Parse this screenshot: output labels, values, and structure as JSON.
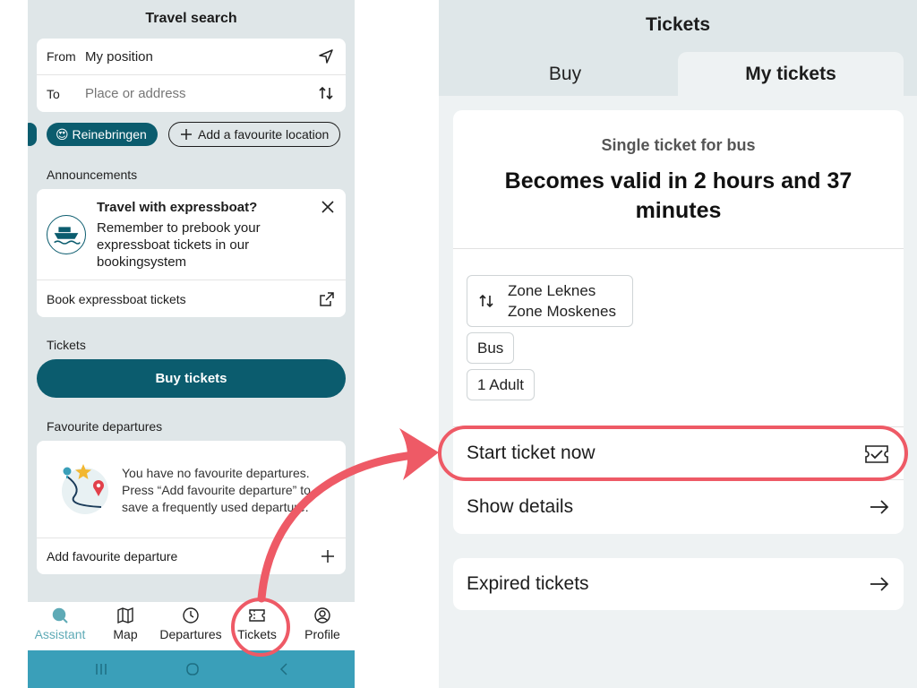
{
  "left": {
    "title": "Travel search",
    "from_label": "From",
    "from_value": "My position",
    "to_label": "To",
    "to_placeholder": "Place or address",
    "fav_location": "😍 Reinebringen",
    "add_fav_location": "Add a favourite location",
    "announcements_label": "Announcements",
    "announcement": {
      "title": "Travel with expressboat?",
      "text": "Remember to prebook your expressboat tickets in our bookingsystem",
      "link": "Book expressboat tickets"
    },
    "tickets_label": "Tickets",
    "buy_tickets": "Buy tickets",
    "fav_departures_label": "Favourite departures",
    "fav_empty_lines": [
      "You have no favourite departures.",
      "Press “Add favourite departure” to",
      "save a frequently used departure."
    ],
    "add_fav_departure": "Add favourite departure",
    "tabs": [
      {
        "label": "Assistant",
        "icon": "search-icon",
        "active": true
      },
      {
        "label": "Map",
        "icon": "map-icon",
        "active": false
      },
      {
        "label": "Departures",
        "icon": "clock-icon",
        "active": false
      },
      {
        "label": "Tickets",
        "icon": "ticket-icon",
        "active": false
      },
      {
        "label": "Profile",
        "icon": "profile-icon",
        "active": false
      }
    ]
  },
  "right": {
    "title": "Tickets",
    "tab_buy": "Buy",
    "tab_my": "My tickets",
    "ticket": {
      "type": "Single ticket for bus",
      "validity": "Becomes valid in 2 hours and 37 minutes",
      "zone_from": "Zone Leknes",
      "zone_to": "Zone Moskenes",
      "mode": "Bus",
      "travellers": "1 Adult"
    },
    "start_now": "Start ticket now",
    "show_details": "Show details",
    "expired": "Expired tickets"
  },
  "colors": {
    "brand": "#0b5c6e",
    "system_bar": "#3a9fb9",
    "highlight": "#ee5a66",
    "active_tab": "#5eaab6"
  }
}
